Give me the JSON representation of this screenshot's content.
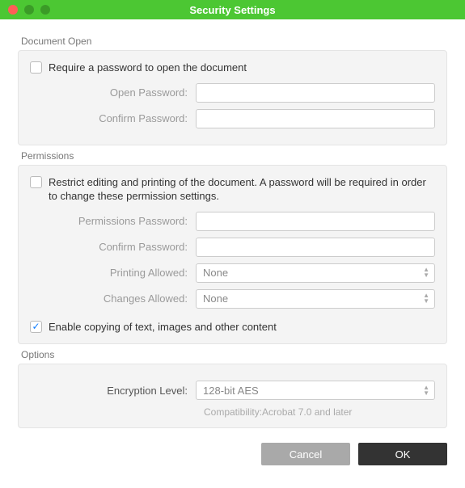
{
  "title": "Security Settings",
  "documentOpen": {
    "sectionLabel": "Document Open",
    "requirePasswordLabel": "Require a password to open the document",
    "requirePasswordChecked": false,
    "openPasswordLabel": "Open Password:",
    "openPasswordValue": "",
    "confirmPasswordLabel": "Confirm Password:",
    "confirmPasswordValue": ""
  },
  "permissions": {
    "sectionLabel": "Permissions",
    "restrictLabel": "Restrict editing and printing of the document. A password will be required in order to change these permission settings.",
    "restrictChecked": false,
    "permPasswordLabel": "Permissions Password:",
    "permPasswordValue": "",
    "confirmPasswordLabel": "Confirm Password:",
    "confirmPasswordValue": "",
    "printingAllowedLabel": "Printing Allowed:",
    "printingAllowedValue": "None",
    "changesAllowedLabel": "Changes Allowed:",
    "changesAllowedValue": "None",
    "enableCopyLabel": "Enable copying of text, images and other content",
    "enableCopyChecked": true
  },
  "options": {
    "sectionLabel": "Options",
    "encryptionLevelLabel": "Encryption Level:",
    "encryptionLevelValue": "128-bit AES",
    "compatibilityNote": "Compatibility:Acrobat 7.0 and later"
  },
  "buttons": {
    "cancel": "Cancel",
    "ok": "OK"
  }
}
